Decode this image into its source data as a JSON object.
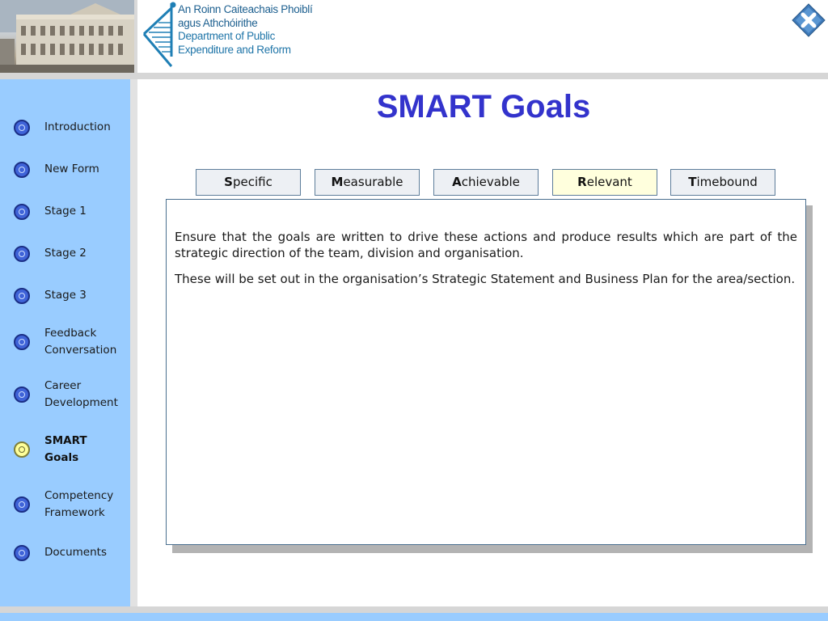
{
  "header": {
    "logo_lines": [
      "An Roinn Caiteachais Phoiblí",
      "agus Athchóirithe",
      "Department of Public",
      "Expenditure and Reform"
    ]
  },
  "colors": {
    "sidebar_bg": "#99ccff",
    "title_blue": "#3333cc",
    "nav_circle": "#3f63d8",
    "nav_active": "#ffff99",
    "tab_active": "#ffffdd"
  },
  "sidebar": {
    "items": [
      {
        "label": "Introduction",
        "icon": "nav-circle-icon",
        "active": false
      },
      {
        "label": "New Form",
        "icon": "nav-circle-icon",
        "active": false
      },
      {
        "label": "Stage 1",
        "icon": "nav-circle-icon",
        "active": false
      },
      {
        "label": "Stage 2",
        "icon": "nav-circle-icon",
        "active": false
      },
      {
        "label": "Stage 3",
        "icon": "nav-circle-icon",
        "active": false
      },
      {
        "label": "Feedback Conversation",
        "icon": "nav-circle-icon",
        "active": false
      },
      {
        "label": "Career Development",
        "icon": "nav-circle-icon",
        "active": false
      },
      {
        "label": "SMART Goals",
        "icon": "nav-circle-icon",
        "active": true
      },
      {
        "label": "Competency Framework",
        "icon": "nav-circle-icon",
        "active": false
      },
      {
        "label": "Documents",
        "icon": "nav-circle-icon",
        "active": false
      }
    ]
  },
  "main": {
    "title": "SMART Goals",
    "tabs": [
      {
        "initial": "S",
        "rest": "pecific",
        "active": false
      },
      {
        "initial": "M",
        "rest": "easurable",
        "active": false
      },
      {
        "initial": "A",
        "rest": "chievable",
        "active": false
      },
      {
        "initial": "R",
        "rest": "elevant",
        "active": true
      },
      {
        "initial": "T",
        "rest": "imebound",
        "active": false
      }
    ],
    "content": {
      "paragraphs": [
        "Ensure that the goals are written to drive these actions and produce results which are part of the strategic direction of the team, division and organisation.",
        "These will be set out in the organisation’s Strategic Statement and Business Plan for the area/section."
      ]
    }
  }
}
